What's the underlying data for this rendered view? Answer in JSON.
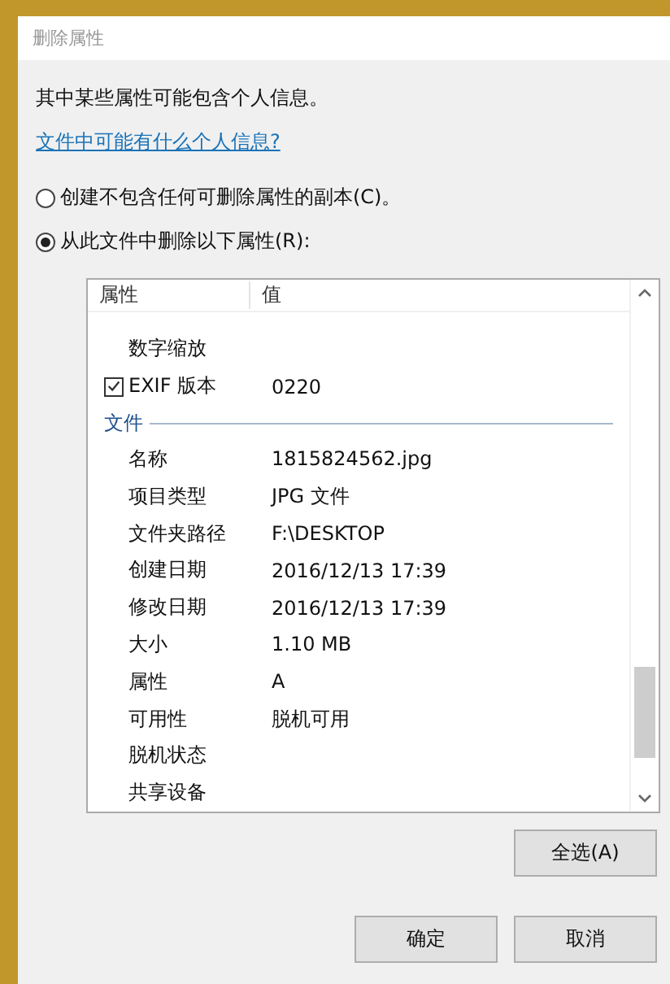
{
  "window": {
    "title": "删除属性"
  },
  "intro": "其中某些属性可能包含个人信息。",
  "help_link": "文件中可能有什么个人信息?",
  "options": [
    {
      "label": "创建不包含任何可删除属性的副本(C)。",
      "selected": false
    },
    {
      "label": "从此文件中删除以下属性(R):",
      "selected": true
    }
  ],
  "table": {
    "columns": [
      "属性",
      "值"
    ],
    "rows": [
      {
        "kind": "plain",
        "name": "数字缩放",
        "value": ""
      },
      {
        "kind": "checkbox",
        "checked": true,
        "name": "EXIF 版本",
        "value": "0220"
      },
      {
        "kind": "group",
        "name": "文件"
      },
      {
        "kind": "plain",
        "name": "名称",
        "value": "1815824562.jpg"
      },
      {
        "kind": "plain",
        "name": "项目类型",
        "value": "JPG 文件"
      },
      {
        "kind": "plain",
        "name": "文件夹路径",
        "value": "F:\\DESKTOP"
      },
      {
        "kind": "plain",
        "name": "创建日期",
        "value": "2016/12/13 17:39"
      },
      {
        "kind": "plain",
        "name": "修改日期",
        "value": "2016/12/13 17:39"
      },
      {
        "kind": "plain",
        "name": "大小",
        "value": "1.10 MB"
      },
      {
        "kind": "plain",
        "name": "属性",
        "value": "A"
      },
      {
        "kind": "plain",
        "name": "可用性",
        "value": "脱机可用"
      },
      {
        "kind": "plain",
        "name": "脱机状态",
        "value": ""
      },
      {
        "kind": "plain",
        "name": "共享设备",
        "value": ""
      }
    ]
  },
  "select_all_button": "全选(A)",
  "buttons": [
    "确定",
    "取消"
  ]
}
